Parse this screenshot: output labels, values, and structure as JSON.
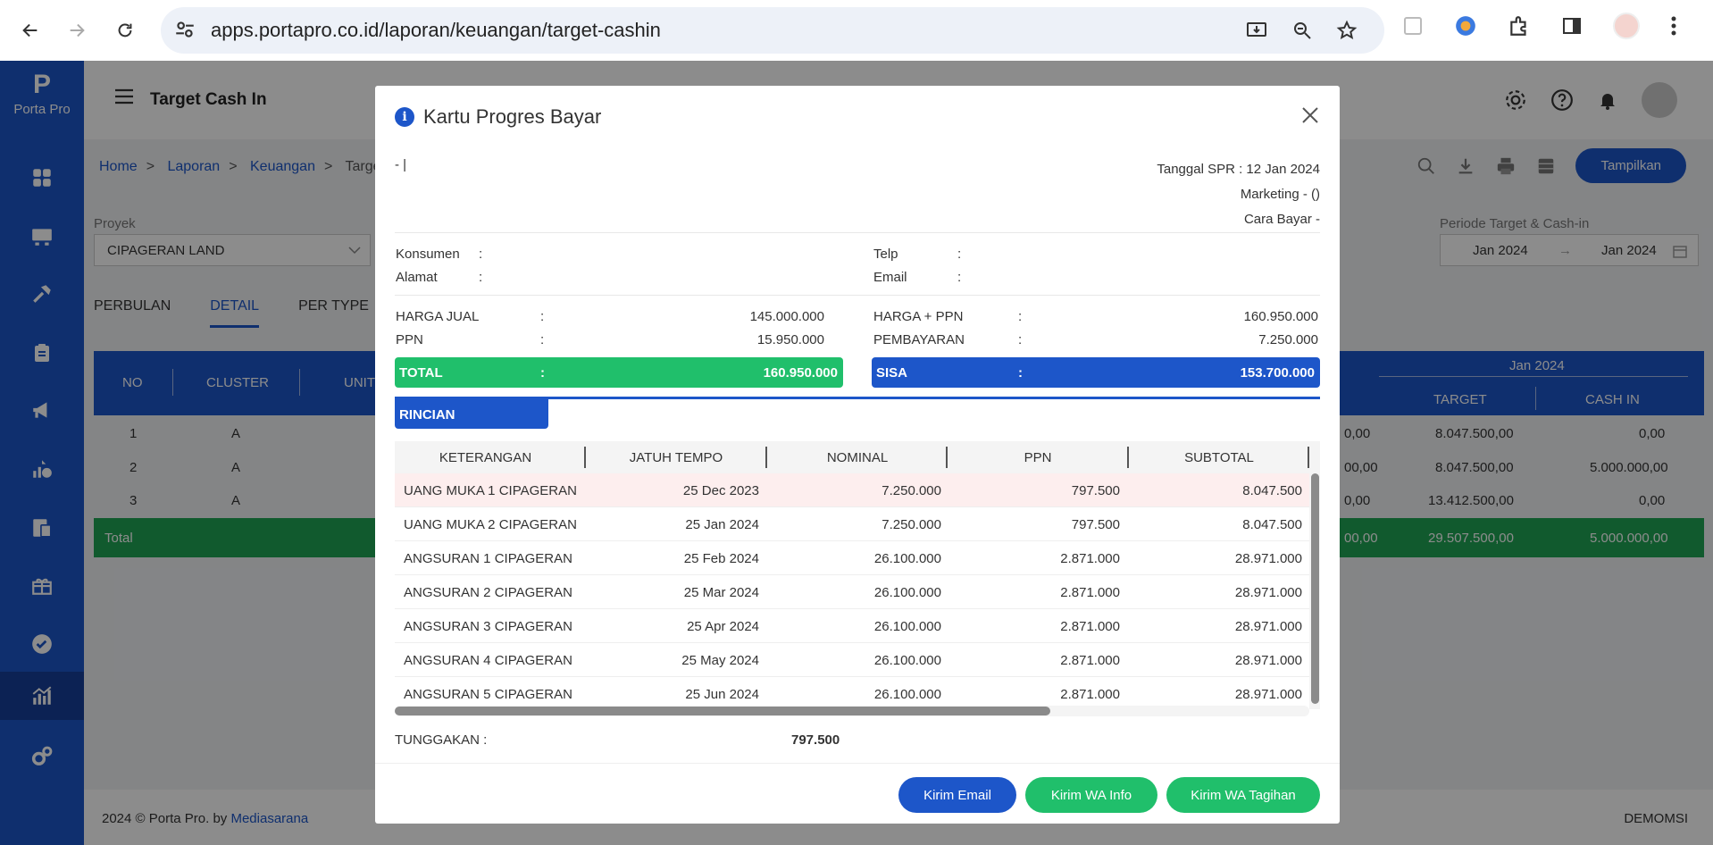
{
  "browser": {
    "url": "apps.portapro.co.id/laporan/keuangan/target-cashin"
  },
  "sidebar": {
    "logo_letter": "P",
    "logo_text": "Porta Pro"
  },
  "header": {
    "title": "Target Cash In"
  },
  "breadcrumb": {
    "home": "Home",
    "laporan": "Laporan",
    "keuangan": "Keuangan",
    "current": "Target C"
  },
  "toolbar": {
    "tampilkan": "Tampilkan"
  },
  "filters": {
    "proyek_label": "Proyek",
    "proyek_value": "CIPAGERAN LAND",
    "periode_label": "Periode Target & Cash-in",
    "periode_from": "Jan 2024",
    "periode_to": "Jan 2024"
  },
  "tabs": [
    "PERBULAN",
    "DETAIL",
    "PER TYPE"
  ],
  "table": {
    "headers": {
      "no": "NO",
      "cluster": "CLUSTER",
      "unit": "UNIT",
      "month": "Jan 2024",
      "target": "TARGET",
      "cashin": "CASH IN"
    },
    "rows": [
      {
        "no": "1",
        "cluster": "A",
        "partial": "0,00",
        "target": "8.047.500,00",
        "cashin": "0,00"
      },
      {
        "no": "2",
        "cluster": "A",
        "partial": "00,00",
        "target": "8.047.500,00",
        "cashin": "5.000.000,00"
      },
      {
        "no": "3",
        "cluster": "A",
        "partial": "0,00",
        "target": "13.412.500,00",
        "cashin": "0,00"
      }
    ],
    "total": {
      "label": "Total",
      "partial": "00,00",
      "target": "29.507.500,00",
      "cashin": "5.000.000,00"
    }
  },
  "footer": {
    "copyright": "2024 © Porta Pro. by ",
    "company": "Mediasarana",
    "user": "DEMOMSI"
  },
  "modal": {
    "title": "Kartu Progres Bayar",
    "left_top": "- |",
    "tanggal_spr": "Tanggal SPR : 12 Jan 2024",
    "marketing": "Marketing - ()",
    "cara_bayar": "Cara Bayar -",
    "konsumen_label": "Konsumen",
    "alamat_label": "Alamat",
    "telp_label": "Telp",
    "email_label": "Email",
    "colon": ":",
    "harga_jual_label": "HARGA JUAL",
    "harga_jual": "145.000.000",
    "ppn_label": "PPN",
    "ppn": "15.950.000",
    "harga_ppn_label": "HARGA + PPN",
    "harga_ppn": "160.950.000",
    "pembayaran_label": "PEMBAYARAN",
    "pembayaran": "7.250.000",
    "total_label": "TOTAL",
    "total": "160.950.000",
    "sisa_label": "SISA",
    "sisa": "153.700.000",
    "rincian_tab": "RINCIAN",
    "grid_headers": [
      "KETERANGAN",
      "JATUH TEMPO",
      "NOMINAL",
      "PPN",
      "SUBTOTAL"
    ],
    "grid_rows": [
      [
        "UANG MUKA 1 CIPAGERAN",
        "25 Dec 2023",
        "7.250.000",
        "797.500",
        "8.047.500"
      ],
      [
        "UANG MUKA 2 CIPAGERAN",
        "25 Jan 2024",
        "7.250.000",
        "797.500",
        "8.047.500"
      ],
      [
        "ANGSURAN 1 CIPAGERAN",
        "25 Feb 2024",
        "26.100.000",
        "2.871.000",
        "28.971.000"
      ],
      [
        "ANGSURAN 2 CIPAGERAN",
        "25 Mar 2024",
        "26.100.000",
        "2.871.000",
        "28.971.000"
      ],
      [
        "ANGSURAN 3 CIPAGERAN",
        "25 Apr 2024",
        "26.100.000",
        "2.871.000",
        "28.971.000"
      ],
      [
        "ANGSURAN 4 CIPAGERAN",
        "25 May 2024",
        "26.100.000",
        "2.871.000",
        "28.971.000"
      ],
      [
        "ANGSURAN 5 CIPAGERAN",
        "25 Jun 2024",
        "26.100.000",
        "2.871.000",
        "28.971.000"
      ]
    ],
    "tunggakan_label": "TUNGGAKAN :",
    "tunggakan": "797.500",
    "btn_email": "Kirim Email",
    "btn_wa_info": "Kirim WA Info",
    "btn_wa_tagihan": "Kirim WA Tagihan"
  },
  "colors": {
    "primary": "#1d56c9",
    "green": "#20bf6b",
    "table_total_green": "#20a454",
    "highlight_row": "#fdeeee"
  }
}
